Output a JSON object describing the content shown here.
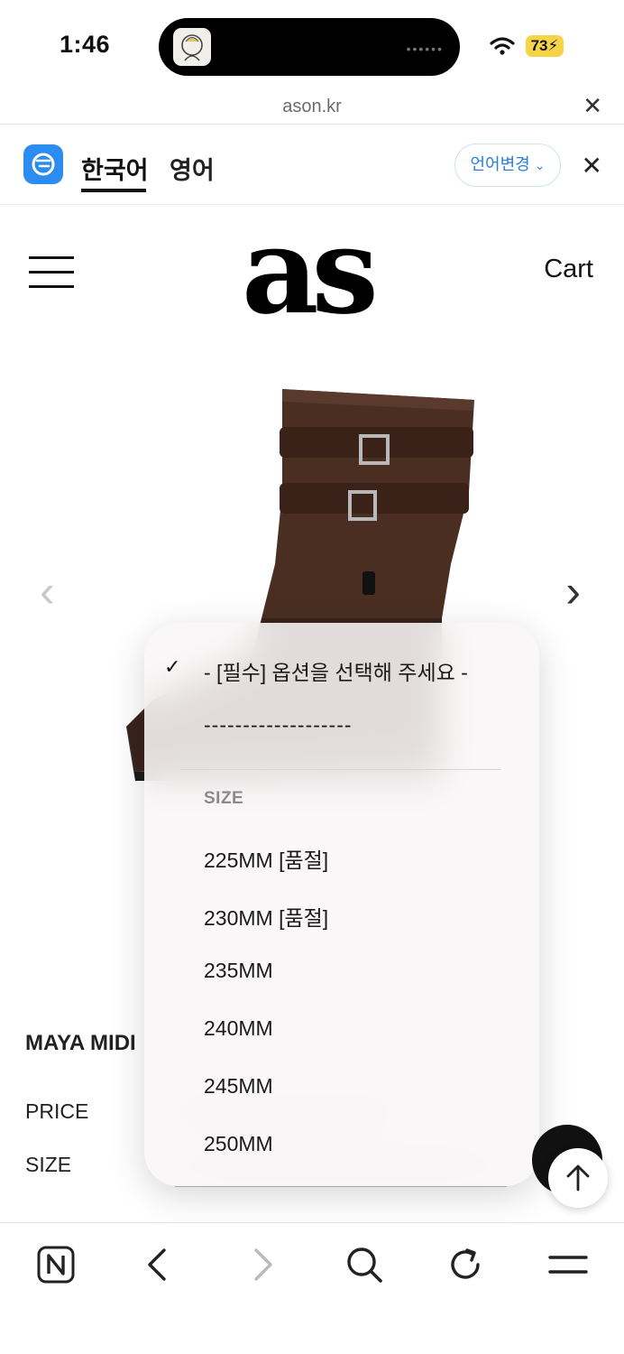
{
  "status": {
    "time": "1:46",
    "battery": "73"
  },
  "url_bar": {
    "domain": "ason.kr"
  },
  "translate_bar": {
    "tab_korean": "한국어",
    "tab_english": "영어",
    "change_language": "언어변경"
  },
  "header": {
    "logo": "as",
    "cart": "Cart"
  },
  "product": {
    "name": "MAYA MIDI",
    "price_label": "PRICE",
    "size_label": "SIZE"
  },
  "dropdown": {
    "selected": "- [필수] 옵션을 선택해 주세요 -",
    "divider_option": "-------------------",
    "group_header": "SIZE",
    "options": [
      "225MM [품절]",
      "230MM [품절]",
      "235MM",
      "240MM",
      "245MM",
      "250MM"
    ]
  },
  "colors": {
    "accent_blue": "#2d8cf0",
    "boot_brown": "#4a2e22"
  }
}
